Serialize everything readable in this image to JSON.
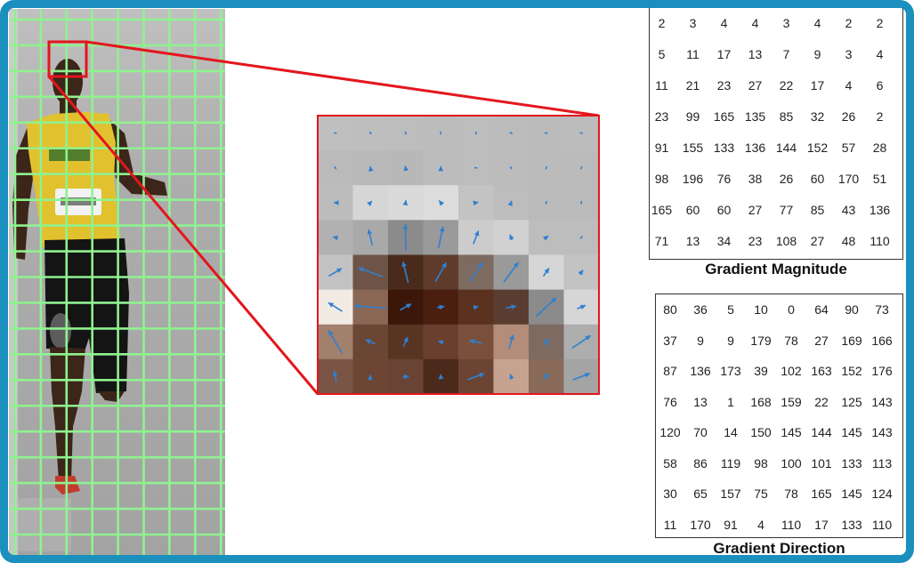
{
  "frame": {
    "border_color": "#1b8fbe"
  },
  "photo": {
    "background_color": "#aaaaaa",
    "grid_color": "#8ff28f",
    "highlight_color": "#e3161d",
    "shirt_color": "#e2c12e",
    "shorts_color": "#141414",
    "skin_color": "#3b2619",
    "shoe_color": "#c23a2e"
  },
  "patch": {
    "border_color": "#e3161d",
    "arrow_color": "#2f80d1",
    "pixels": [
      [
        "#bfbfbf",
        "#bebebe",
        "#bdbdbd",
        "#bcbcbc",
        "#bdbdbd",
        "#bcbcbc",
        "#bbbbbb",
        "#bcbcbc"
      ],
      [
        "#bababa",
        "#b9b9b9",
        "#b8b8b8",
        "#bcbcbc",
        "#bdbdbd",
        "#bcbcbc",
        "#bbbbbb",
        "#bbbbbb"
      ],
      [
        "#bcbcbc",
        "#d6d6d6",
        "#dadada",
        "#dcdcdc",
        "#c3c3c3",
        "#bdbdbd",
        "#bababa",
        "#bbbbbb"
      ],
      [
        "#b1b1b1",
        "#a9a9a9",
        "#8b8b8b",
        "#9a9a9a",
        "#cccccc",
        "#d1d1d1",
        "#bdbdbd",
        "#bdbdbd"
      ],
      [
        "#c2c2c2",
        "#6e5447",
        "#4a2a1b",
        "#5f3b2b",
        "#7d6a60",
        "#9a9a9a",
        "#d6d6d6",
        "#c3c3c3"
      ],
      [
        "#f1ebe4",
        "#8a6655",
        "#3c1609",
        "#4a1f10",
        "#5b3220",
        "#5a3d30",
        "#8b8b8b",
        "#d6d6d6"
      ],
      [
        "#a2806e",
        "#6c4634",
        "#583423",
        "#6a3f2d",
        "#7a4f3c",
        "#b48c7a",
        "#7d6b62",
        "#adadad"
      ],
      [
        "#7a5444",
        "#6c4534",
        "#694333",
        "#4c2a1b",
        "#6b4433",
        "#c6a391",
        "#8a6a59",
        "#a4a4a4"
      ]
    ]
  },
  "gradient_magnitude": {
    "title": "Gradient Magnitude",
    "rows": [
      [
        2,
        3,
        4,
        4,
        3,
        4,
        2,
        2
      ],
      [
        5,
        11,
        17,
        13,
        7,
        9,
        3,
        4
      ],
      [
        11,
        21,
        23,
        27,
        22,
        17,
        4,
        6
      ],
      [
        23,
        99,
        165,
        135,
        85,
        32,
        26,
        2
      ],
      [
        91,
        155,
        133,
        136,
        144,
        152,
        57,
        28
      ],
      [
        98,
        196,
        76,
        38,
        26,
        60,
        170,
        51
      ],
      [
        165,
        60,
        60,
        27,
        77,
        85,
        43,
        136
      ],
      [
        71,
        13,
        34,
        23,
        108,
        27,
        48,
        110
      ]
    ]
  },
  "gradient_direction": {
    "title": "Gradient Direction",
    "rows": [
      [
        80,
        36,
        5,
        10,
        0,
        64,
        90,
        73
      ],
      [
        37,
        9,
        9,
        179,
        78,
        27,
        169,
        166
      ],
      [
        87,
        136,
        173,
        39,
        102,
        163,
        152,
        176
      ],
      [
        76,
        13,
        1,
        168,
        159,
        22,
        125,
        143
      ],
      [
        120,
        70,
        14,
        150,
        145,
        144,
        145,
        143
      ],
      [
        58,
        86,
        119,
        98,
        100,
        101,
        133,
        113
      ],
      [
        30,
        65,
        157,
        75,
        78,
        165,
        145,
        124
      ],
      [
        11,
        170,
        91,
        4,
        110,
        17,
        133,
        110
      ]
    ]
  }
}
